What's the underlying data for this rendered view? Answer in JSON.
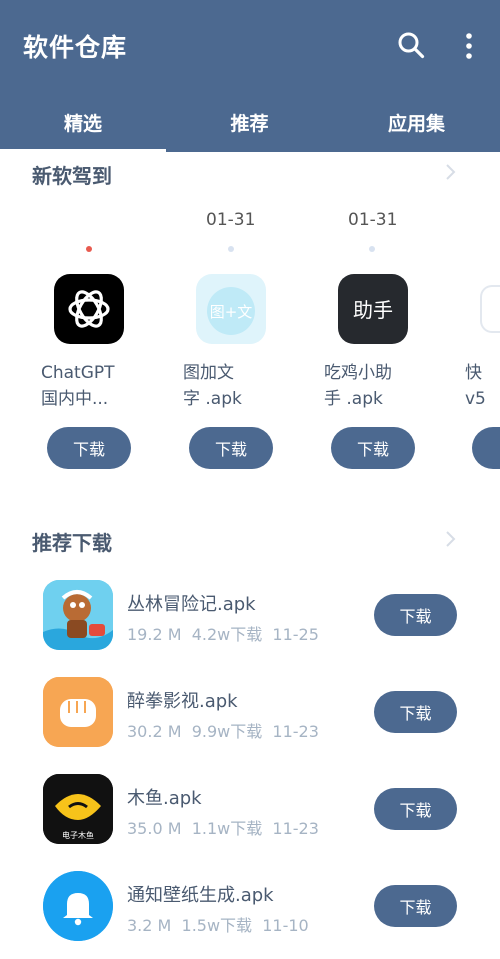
{
  "app": {
    "title": "软件仓库"
  },
  "icons": {
    "search": "search-icon",
    "more": "more-vert-icon",
    "chevron": "chevron-right-icon"
  },
  "tabs": [
    {
      "label": "精选",
      "active": true
    },
    {
      "label": "推荐"
    },
    {
      "label": "应用集"
    }
  ],
  "new_section": {
    "title": "新软驾到",
    "cards": [
      {
        "date": "",
        "name_line1": "ChatGPT",
        "name_line2": "国内中...",
        "button": "下载",
        "icon_text": ""
      },
      {
        "date": "01-31",
        "name_line1": "图加文",
        "name_line2": "字 .apk",
        "button": "下载",
        "icon_text": "图+文"
      },
      {
        "date": "01-31",
        "name_line1": "吃鸡小助",
        "name_line2": "手 .apk",
        "button": "下载",
        "icon_text": "助手"
      },
      {
        "date": "",
        "name_line1": "快",
        "name_line2": "v5",
        "button": "",
        "icon_text": ""
      }
    ]
  },
  "recommend_section": {
    "title": "推荐下载",
    "items": [
      {
        "name": "丛林冒险记.apk",
        "meta": "19.2 M  4.2w下载  11-25",
        "button": "下载"
      },
      {
        "name": "醉拳影视.apk",
        "meta": "30.2 M  9.9w下载  11-23",
        "button": "下载"
      },
      {
        "name": "木鱼.apk",
        "meta": "35.0 M  1.1w下载  11-23",
        "button": "下载",
        "icon_caption": "电子木鱼"
      },
      {
        "name": "通知壁纸生成.apk",
        "meta": "3.2 M  1.5w下载  11-10",
        "button": "下载"
      }
    ]
  },
  "colors": {
    "primary": "#4c6990",
    "accent_dot": "#e85a4f",
    "text_muted": "#a6b4c4"
  }
}
